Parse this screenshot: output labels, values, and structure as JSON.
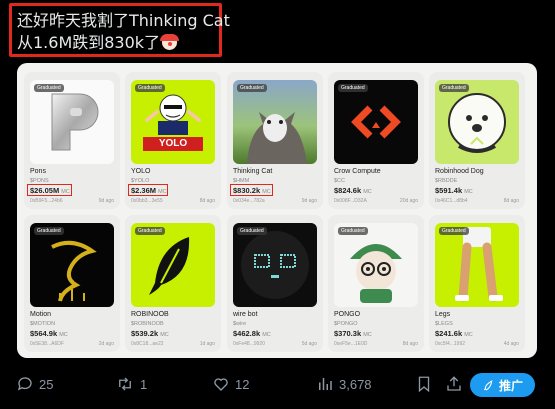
{
  "caption": {
    "line1": "还好昨天我割了Thinking Cat",
    "line2": "从1.6M跌到830k了"
  },
  "cards": [
    {
      "badge": "Graduated",
      "name": "Pons",
      "ticker": "$PONS",
      "mc": "$26.05M",
      "unit": "MC",
      "addr": "0xB9F5...24b6",
      "ago": "9d ago",
      "highlight": true
    },
    {
      "badge": "Graduated",
      "name": "YOLO",
      "ticker": "$YOLO",
      "mc": "$2.36M",
      "unit": "MC",
      "addr": "0x0bb3...3e55",
      "ago": "8d ago",
      "highlight": true
    },
    {
      "badge": "Graduated",
      "name": "Thinking Cat",
      "ticker": "$HMM",
      "mc": "$830.2k",
      "unit": "MC",
      "addr": "0x034e...782a",
      "ago": "9d ago",
      "highlight": true
    },
    {
      "badge": "Graduated",
      "name": "Crow Compute",
      "ticker": "$CC",
      "mc": "$824.6k",
      "unit": "MC",
      "addr": "0x008F...D32A",
      "ago": "20d ago",
      "highlight": false
    },
    {
      "badge": "Graduated",
      "name": "Robinhood Dog",
      "ticker": "$RBDDE",
      "mc": "$591.4k",
      "unit": "MC",
      "addr": "0x46C1...d8b4",
      "ago": "8d ago",
      "highlight": false
    },
    {
      "badge": "Graduated",
      "name": "Motion",
      "ticker": "$MOTION",
      "mc": "$564.9k",
      "unit": "MC",
      "addr": "0x5E38...A6DF",
      "ago": "2d ago",
      "highlight": false
    },
    {
      "badge": "Graduated",
      "name": "ROBINOOB",
      "ticker": "$ROBINOOB",
      "mc": "$539.2k",
      "unit": "MC",
      "addr": "0x8C18...ae22",
      "ago": "1d ago",
      "highlight": false
    },
    {
      "badge": "Graduated",
      "name": "wire bot",
      "ticker": "$wire",
      "mc": "$462.8k",
      "unit": "MC",
      "addr": "0xFe48...9920",
      "ago": "5d ago",
      "highlight": false
    },
    {
      "badge": "Graduated",
      "name": "PONGO",
      "ticker": "$PONGO",
      "mc": "$370.3k",
      "unit": "MC",
      "addr": "0xeF5e...1E0D",
      "ago": "8d ago",
      "highlight": false
    },
    {
      "badge": "Graduated",
      "name": "Legs",
      "ticker": "$LEGS",
      "mc": "$241.6k",
      "unit": "MC",
      "addr": "0xc5f4...1992",
      "ago": "4d ago",
      "highlight": false
    }
  ],
  "yolo_banner": "YOLO",
  "actions": {
    "replies": "25",
    "reposts": "1",
    "likes": "12",
    "views": "3,678",
    "promote": "推广"
  }
}
